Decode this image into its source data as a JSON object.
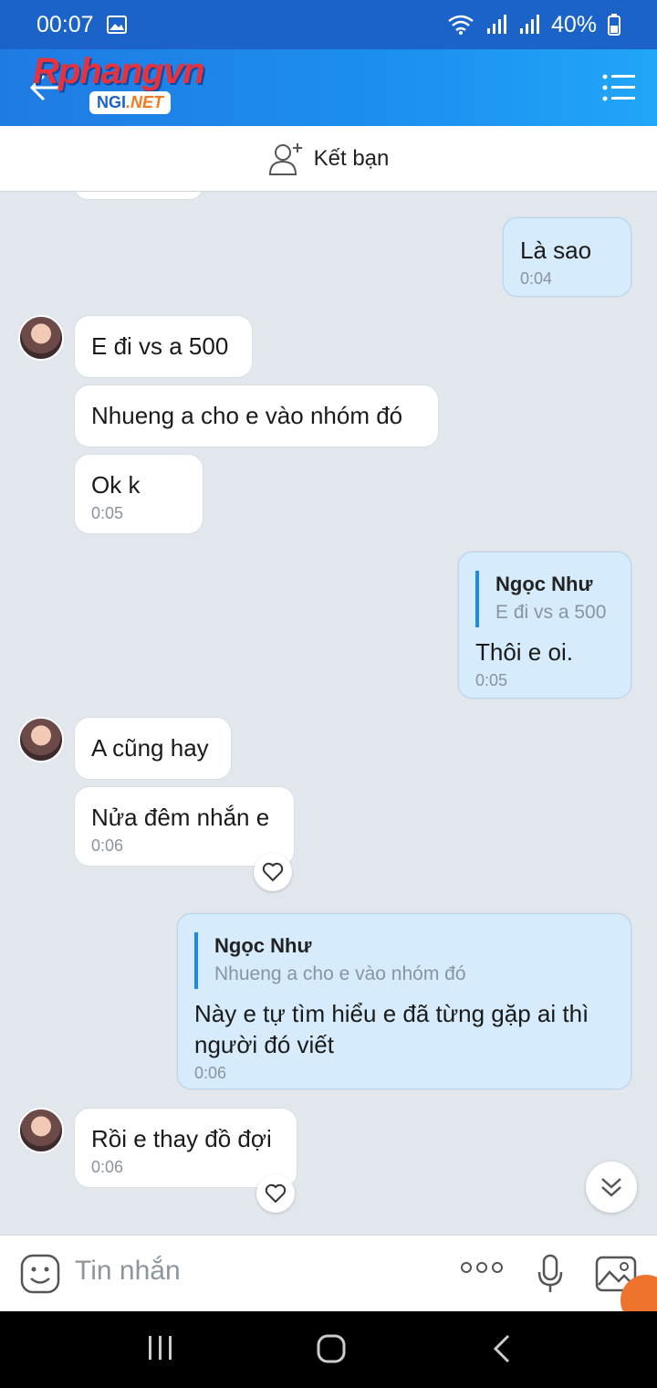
{
  "status": {
    "time": "00:07",
    "battery": "40%"
  },
  "header": {
    "logo_main": "Rphangvn",
    "logo_badge_prefix": "NGI",
    "logo_badge_suffix": ".NET"
  },
  "add_friend": {
    "label": "Kết bạn"
  },
  "messages": [
    {
      "text": "Là sao",
      "time": "0:04"
    },
    {
      "text": "E đi vs a 500"
    },
    {
      "text": "Nhueng a cho e vào nhóm đó"
    },
    {
      "text": "Ok k",
      "time": "0:05"
    },
    {
      "quote_name": "Ngọc Như",
      "quote_text": "E đi vs a 500",
      "text": "Thôi e oi.",
      "time": "0:05"
    },
    {
      "text": "A cũng hay"
    },
    {
      "text": "Nửa đêm nhắn e",
      "time": "0:06"
    },
    {
      "quote_name": "Ngọc Như",
      "quote_text": "Nhueng a cho e vào nhóm đó",
      "text": "Này e tự tìm hiểu e đã từng gặp ai thì người đó viết",
      "time": "0:06"
    },
    {
      "text": "Rồi e thay đồ đợi",
      "time": "0:06"
    }
  ],
  "input": {
    "placeholder": "Tin nhắn"
  }
}
